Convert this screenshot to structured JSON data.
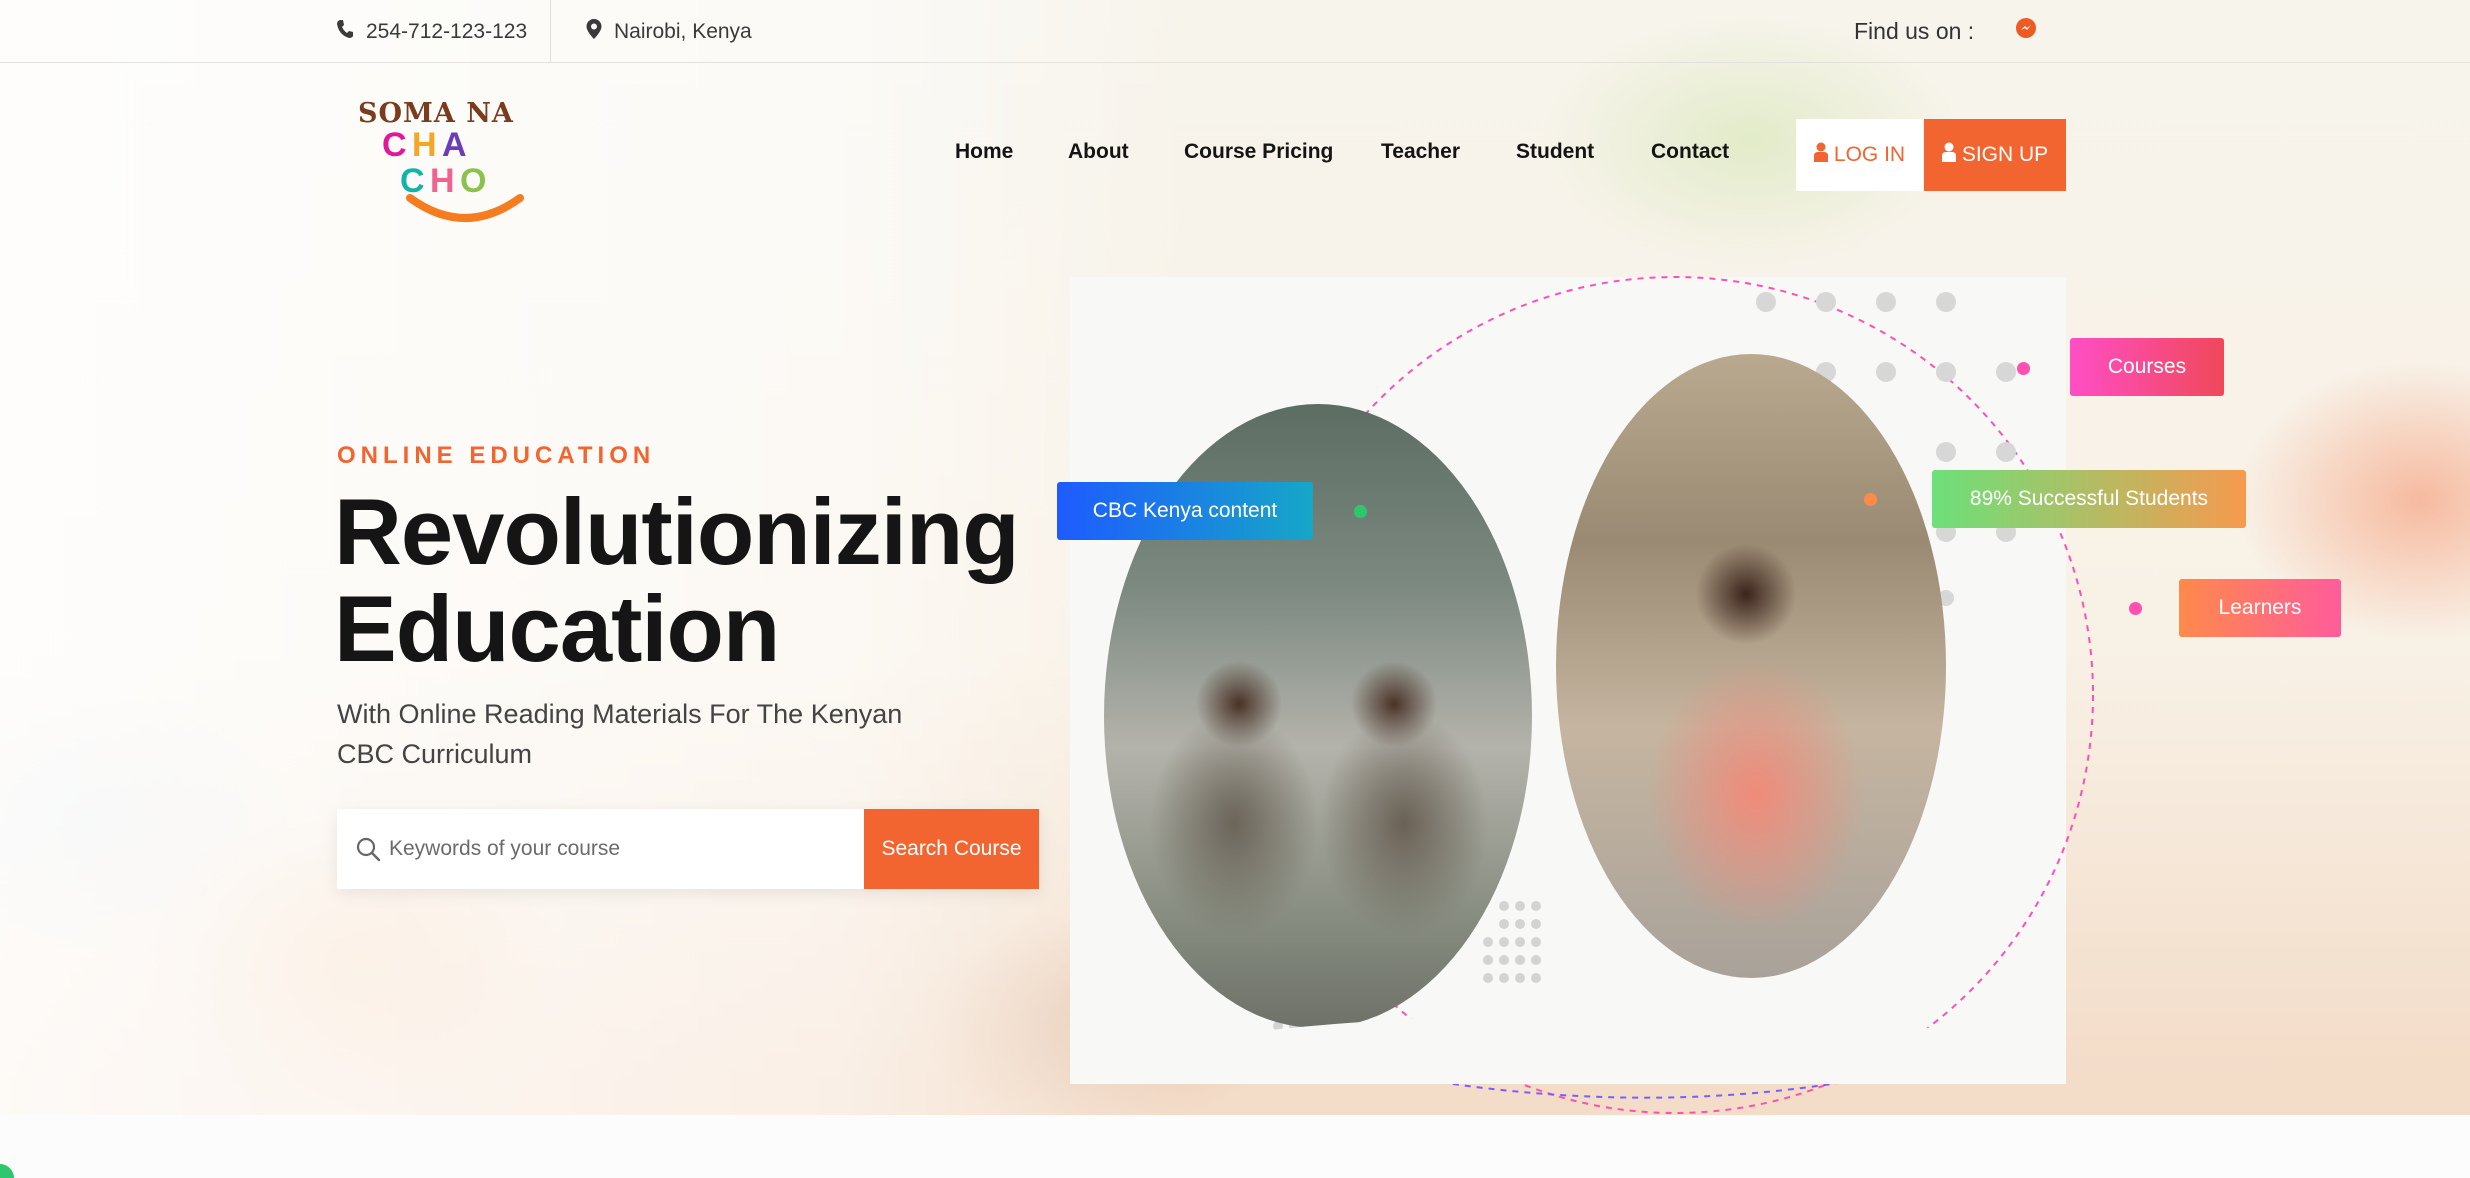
{
  "topbar": {
    "phone": "254-712-123-123",
    "location": "Nairobi, Kenya",
    "find_us": "Find us on :",
    "social_icon": "messenger-icon"
  },
  "logo": {
    "text_top": "SOMA NA",
    "text_bottom": "CHACHO"
  },
  "nav": {
    "items": [
      "Home",
      "About",
      "Course Pricing",
      "Teacher",
      "Student",
      "Contact"
    ],
    "login": "LOG IN",
    "signup": "SIGN UP"
  },
  "hero": {
    "eyebrow": "ONLINE EDUCATION",
    "headline_line1": "Revolutionizing",
    "headline_line2": "Education",
    "subtitle": "With Online Reading Materials For The Kenyan CBC Curriculum",
    "search_placeholder": "Keywords of your course",
    "search_button": "Search Course"
  },
  "badges": {
    "cbc": "CBC Kenya content",
    "courses": "Courses",
    "success": "89% Successful Students",
    "learners": "Learners"
  },
  "colors": {
    "accent": "#f26531",
    "text_dark": "#151515"
  }
}
